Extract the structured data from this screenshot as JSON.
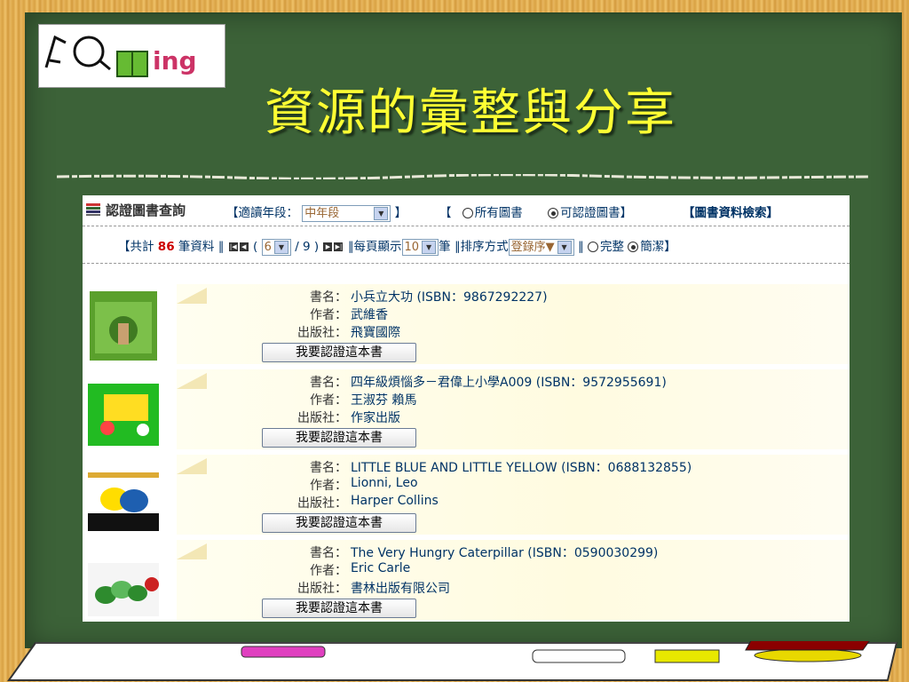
{
  "slide": {
    "title": "資源的彙整與分享",
    "logo_text": "ing"
  },
  "panel": {
    "title": "認證圖書查詢",
    "grade_label": "【適讀年段：",
    "grade_value": "中年段",
    "grade_close": "】",
    "filter_open": "【",
    "filter_all": "所有圖書",
    "filter_certified": "可認證圖書",
    "filter_close": "】",
    "search_link": "【圖書資料檢索】",
    "total_prefix": "【共計",
    "total_count": "86",
    "total_suffix": "筆資料 ∥",
    "page_open": "(",
    "page_value": "6",
    "page_total": "/ 9 )",
    "per_page_label": "∥每頁顯示",
    "per_page_value": "10",
    "per_page_unit": "筆 ∥排序方式",
    "sort_value": "登錄序▼",
    "view_sep": "∥",
    "view_full": "完整",
    "view_brief": "簡潔",
    "view_close": "】"
  },
  "labels": {
    "title": "書名：",
    "author": "作者：",
    "publisher": "出版社："
  },
  "books": [
    {
      "title": "小兵立大功 (ISBN：9867292227)",
      "author": "武維香",
      "publisher": "飛寶國際",
      "button": "我要認證這本書"
    },
    {
      "title": "四年級煩惱多－君偉上小學A009 (ISBN：9572955691)",
      "author": "王淑芬 賴馬",
      "publisher": "作家出版",
      "button": "我要認證這本書"
    },
    {
      "title": "LITTLE BLUE AND LITTLE YELLOW (ISBN：0688132855)",
      "author": "Lionni, Leo",
      "publisher": "Harper Collins",
      "button": "我要認證這本書"
    },
    {
      "title": "The Very Hungry Caterpillar (ISBN：0590030299)",
      "author": "Eric Carle",
      "publisher": "書林出版有限公司",
      "button": "我要認證這本書"
    }
  ],
  "colors": {
    "board": "#3c6238",
    "title": "#ffff33",
    "link": "#003366",
    "count": "#cc0000"
  }
}
